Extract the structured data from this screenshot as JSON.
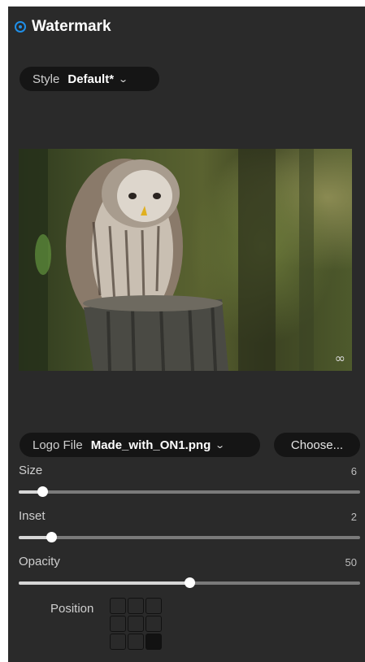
{
  "panel": {
    "title": "Watermark",
    "radio_icon": "radio-selected-icon",
    "accent": "#1f8fe8"
  },
  "style": {
    "label": "Style",
    "value": "Default*",
    "chevron_icon": "chevron-down-icon"
  },
  "preview": {
    "image": "owl photo with watermark logo",
    "watermark_glyph": "∞"
  },
  "logo_file": {
    "label": "Logo File",
    "value": "Made_with_ON1.png",
    "choose_label": "Choose..."
  },
  "sliders": [
    {
      "label": "Size",
      "value": "6",
      "level": 0.07
    },
    {
      "label": "Inset",
      "value": "2",
      "level": 0.095
    },
    {
      "label": "Opacity",
      "value": "50",
      "level": 0.5
    }
  ],
  "position": {
    "label": "Position",
    "selected": "bottom-right"
  }
}
